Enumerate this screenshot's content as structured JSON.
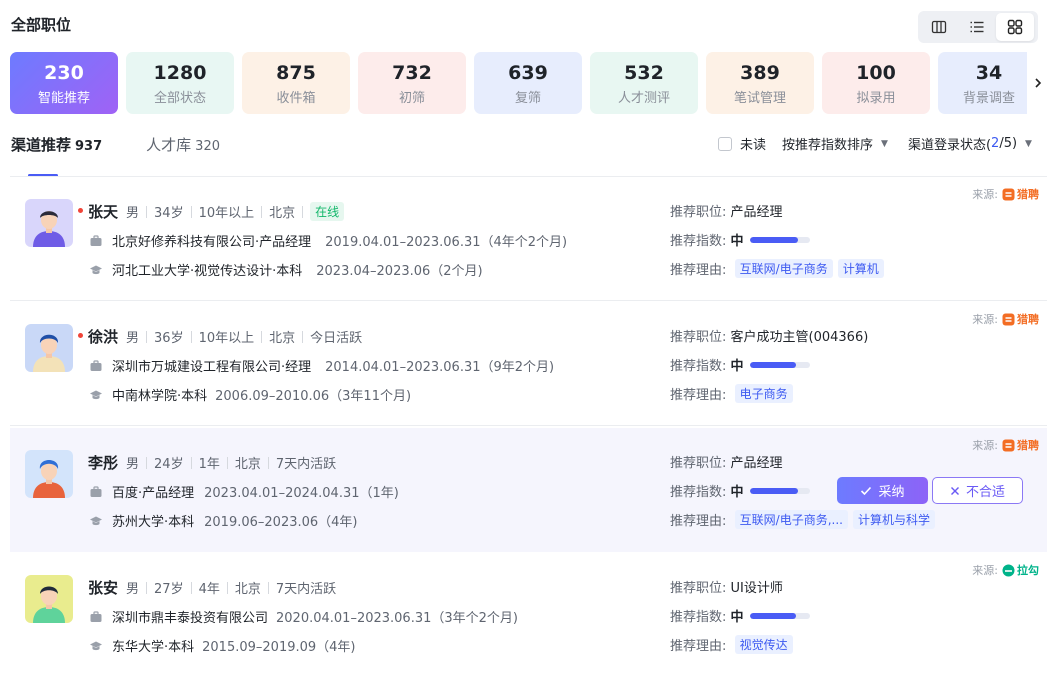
{
  "page": {
    "title": "全部职位"
  },
  "view_switch": {
    "options": [
      "column-view-icon",
      "list-view-icon",
      "grid-view-icon"
    ],
    "active": "grid-view-icon"
  },
  "stats": [
    {
      "value": "230",
      "label": "智能推荐",
      "active": true,
      "bg": "#7b6cf6"
    },
    {
      "value": "1280",
      "label": "全部状态",
      "bg": "#e8f7f3"
    },
    {
      "value": "875",
      "label": "收件箱",
      "bg": "#fdf1e6"
    },
    {
      "value": "732",
      "label": "初筛",
      "bg": "#fdeceb"
    },
    {
      "value": "639",
      "label": "复筛",
      "bg": "#e7edfd"
    },
    {
      "value": "532",
      "label": "人才测评",
      "bg": "#e8f7f2"
    },
    {
      "value": "389",
      "label": "笔试管理",
      "bg": "#fdf1e6"
    },
    {
      "value": "100",
      "label": "拟录用",
      "bg": "#fdeceb"
    },
    {
      "value": "34",
      "label": "背景调查",
      "bg": "#e7edfd"
    }
  ],
  "tabs": [
    {
      "label": "渠道推荐",
      "count": "937",
      "active": true
    },
    {
      "label": "人才库",
      "count": "320",
      "active": false
    }
  ],
  "filters": {
    "unread_label": "未读",
    "sort_label": "按推荐指数排序",
    "channel_label_prefix": "渠道登录状态(",
    "channel_count": "2",
    "channel_label_suffix": "/5)"
  },
  "labels": {
    "rec_position": "推荐职位:",
    "rec_index": "推荐指数:",
    "rec_reason": "推荐理由:",
    "source": "来源:",
    "accept": "采纳",
    "reject": "不合适"
  },
  "candidates": [
    {
      "name": "张天",
      "unread": true,
      "gender": "男",
      "age": "34岁",
      "experience": "10年以上",
      "city": "北京",
      "activity": "在线",
      "activity_badge": true,
      "company": "北京好修养科技有限公司·产品经理",
      "company_period": "2019.04.01–2023.06.31（4年个2个月)",
      "school": "河北工业大学·视觉传达设计·本科",
      "school_period": "2023.04–2023.06（2个月)",
      "position": "产品经理",
      "index_level": "中",
      "index_fraction": 0.8,
      "reasons": [
        "互联网/电子商务",
        "计算机"
      ],
      "source_name": "猎聘",
      "source_color": "#f36d24"
    },
    {
      "name": "徐洪",
      "unread": true,
      "gender": "男",
      "age": "36岁",
      "experience": "10年以上",
      "city": "北京",
      "activity": "今日活跃",
      "activity_badge": false,
      "company": "深圳市万城建设工程有限公司·经理",
      "company_period": "2014.04.01–2023.06.31（9年2个月)",
      "school": "中南林学院·本科",
      "school_period": "2006.09–2010.06（3年11个月)",
      "position": "客户成功主管(004366)",
      "index_level": "中",
      "index_fraction": 0.78,
      "reasons": [
        "电子商务"
      ],
      "source_name": "猎聘",
      "source_color": "#f36d24"
    },
    {
      "name": "李彤",
      "unread": false,
      "gender": "男",
      "age": "24岁",
      "experience": "1年",
      "city": "北京",
      "activity": "7天内活跃",
      "activity_badge": false,
      "company": "百度·产品经理",
      "company_period": "2023.04.01–2024.04.31（1年)",
      "school": "苏州大学·本科",
      "school_period": "2019.06–2023.06（4年)",
      "position": "产品经理",
      "index_level": "中",
      "index_fraction": 0.8,
      "reasons": [
        "互联网/电子商务,...",
        "计算机与科学"
      ],
      "source_name": "猎聘",
      "source_color": "#f36d24",
      "hover": true
    },
    {
      "name": "张安",
      "unread": false,
      "gender": "男",
      "age": "27岁",
      "experience": "4年",
      "city": "北京",
      "activity": "7天内活跃",
      "activity_badge": false,
      "company": "深圳市鼎丰泰投资有限公司",
      "company_period": "2020.04.01–2023.06.31（3年个2个月)",
      "school": "东华大学·本科",
      "school_period": "2015.09–2019.09（4年)",
      "position": "UI设计师",
      "index_level": "中",
      "index_fraction": 0.78,
      "reasons": [
        "视觉传达"
      ],
      "source_name": "拉勾",
      "source_color": "#00b38a"
    }
  ]
}
